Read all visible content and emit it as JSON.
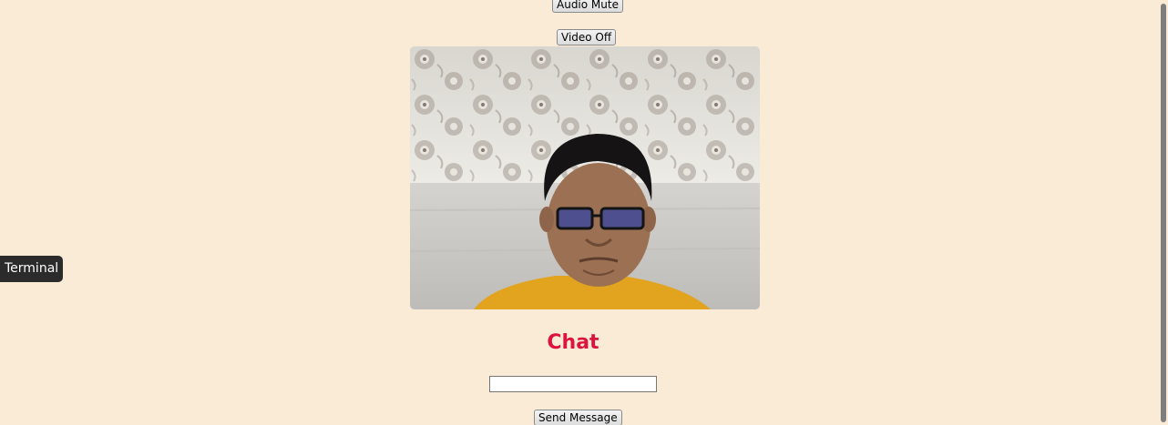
{
  "controls": {
    "audio_button_label": "Audio Mute",
    "video_button_label": "Video Off"
  },
  "chat": {
    "title": "Chat",
    "input_value": "",
    "send_button_label": "Send Message"
  },
  "dock_tooltip": {
    "label": "Terminal"
  },
  "colors": {
    "page_background": "#faebd7",
    "chat_title": "#dc143c"
  }
}
